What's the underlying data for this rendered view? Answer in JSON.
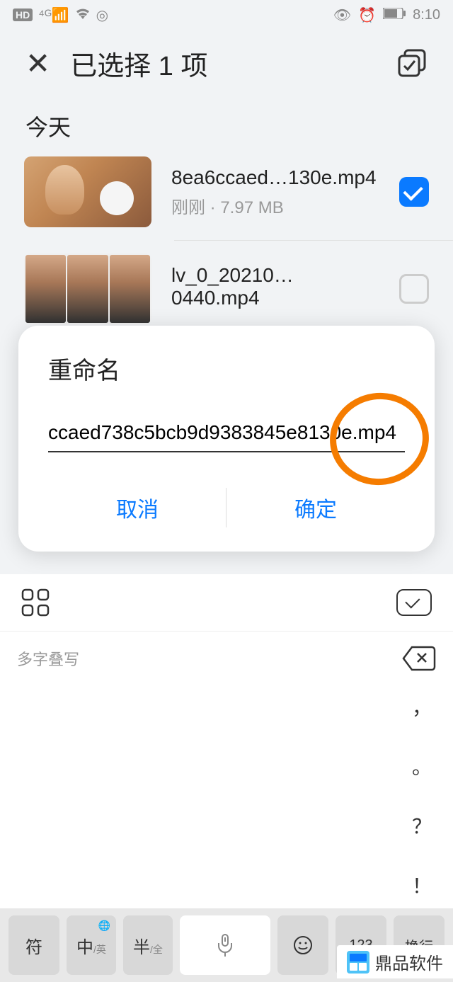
{
  "statusBar": {
    "hd": "HD",
    "time": "8:10"
  },
  "header": {
    "title": "已选择 1 项"
  },
  "section": {
    "label": "今天"
  },
  "files": [
    {
      "name": "8ea6ccaed…130e.mp4",
      "meta": "刚刚 · 7.97 MB"
    },
    {
      "name": "lv_0_20210…0440.mp4",
      "meta": ""
    }
  ],
  "dialog": {
    "title": "重命名",
    "value": "ccaed738c5bcb9d9383845e8130e.mp4",
    "cancel": "取消",
    "confirm": "确定"
  },
  "keyboard": {
    "suggest": "多字叠写",
    "sideKeys": [
      "，",
      "。",
      "？",
      "！"
    ],
    "bottom": {
      "sym": "符",
      "cn": "中",
      "cnSub": "/英",
      "half": "半",
      "halfSub": "/全",
      "emoji": "☺",
      "num": "123",
      "enter": "换行"
    }
  },
  "watermark": "鼎品软件"
}
